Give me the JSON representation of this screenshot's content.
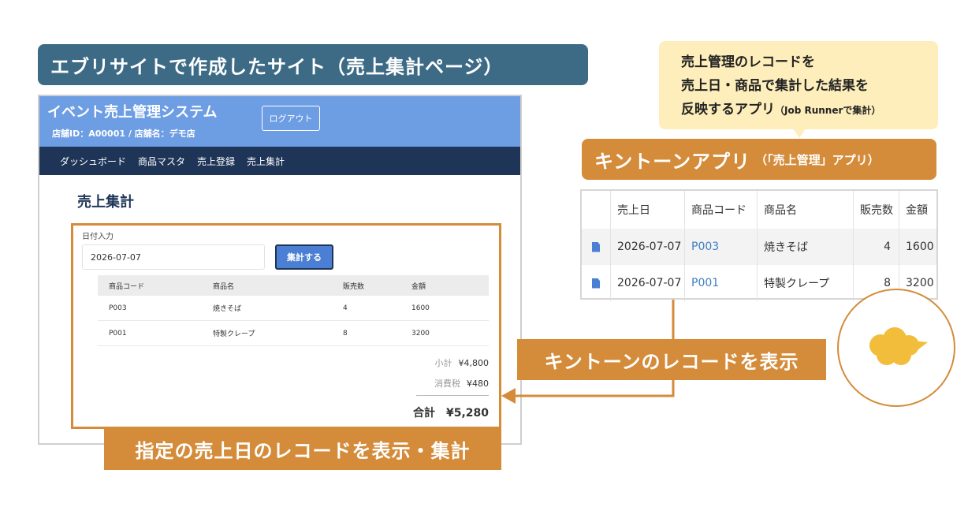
{
  "title_banner": "エブリサイトで作成したサイト（売上集計ページ）",
  "site": {
    "title": "イベント売上管理システム",
    "store_info": "店舗ID：A00001 / 店舗名：デモ店",
    "logout_label": "ログアウト",
    "nav": [
      "ダッシュボード",
      "商品マスタ",
      "売上登録",
      "売上集計"
    ],
    "page_heading": "売上集計",
    "date_label": "日付入力",
    "date_value": "2026-07-07",
    "aggregate_button": "集計する",
    "table": {
      "headers": [
        "商品コード",
        "商品名",
        "販売数",
        "金額"
      ],
      "rows": [
        [
          "P003",
          "焼きそば",
          "4",
          "1600"
        ],
        [
          "P001",
          "特製クレープ",
          "8",
          "3200"
        ]
      ]
    },
    "subtotal_label": "小計",
    "subtotal_value": "¥4,800",
    "tax_label": "消費税",
    "tax_value": "¥480",
    "total_label": "合計",
    "total_value": "¥5,280"
  },
  "bottom_label": "指定の売上日のレコードを表示・集計",
  "callout": {
    "line1": "売上管理のレコードを",
    "line2": "売上日・商品で集計した結果を",
    "line3_main": "反映するアプリ",
    "line3_small": "（Job Runnerで集計）"
  },
  "app_banner": {
    "main": "キントーンアプリ",
    "sub": "（「売上管理」アプリ）"
  },
  "kintone_table": {
    "headers": [
      "売上日",
      "商品コード",
      "商品名",
      "販売数",
      "金額"
    ],
    "rows": [
      [
        "2026-07-07",
        "P003",
        "焼きそば",
        "4",
        "1600"
      ],
      [
        "2026-07-07",
        "P001",
        "特製クレープ",
        "8",
        "3200"
      ]
    ]
  },
  "show_label": "キントーンのレコードを表示",
  "colors": {
    "accent_orange": "#d48b3a",
    "banner_blue": "#3d6b86",
    "header_blue": "#6d9de3",
    "nav_navy": "#1e3557",
    "cloud_yellow": "#f2bd3b"
  },
  "icons": {
    "record_icon": "document-icon",
    "logo": "kintone-cloud-icon"
  }
}
